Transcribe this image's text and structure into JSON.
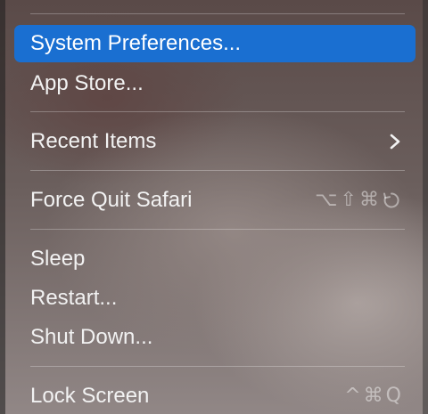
{
  "menu": {
    "items": [
      {
        "label": "System Preferences...",
        "highlighted": true
      },
      {
        "label": "App Store..."
      },
      {
        "label": "Recent Items",
        "submenu": "chevron-right-icon"
      },
      {
        "label": "Force Quit Safari",
        "shortcut": [
          "⌥",
          "⇧",
          "⌘"
        ],
        "shortcut_icon": "escape-key-icon"
      },
      {
        "label": "Sleep"
      },
      {
        "label": "Restart..."
      },
      {
        "label": "Shut Down..."
      },
      {
        "label": "Lock Screen",
        "shortcut": [
          "^",
          "⌘",
          "Q"
        ]
      }
    ]
  },
  "colors": {
    "highlight": "#1a6fd1",
    "text": "#f2f2f2",
    "shortcut_text": "rgba(255,255,255,0.45)"
  }
}
